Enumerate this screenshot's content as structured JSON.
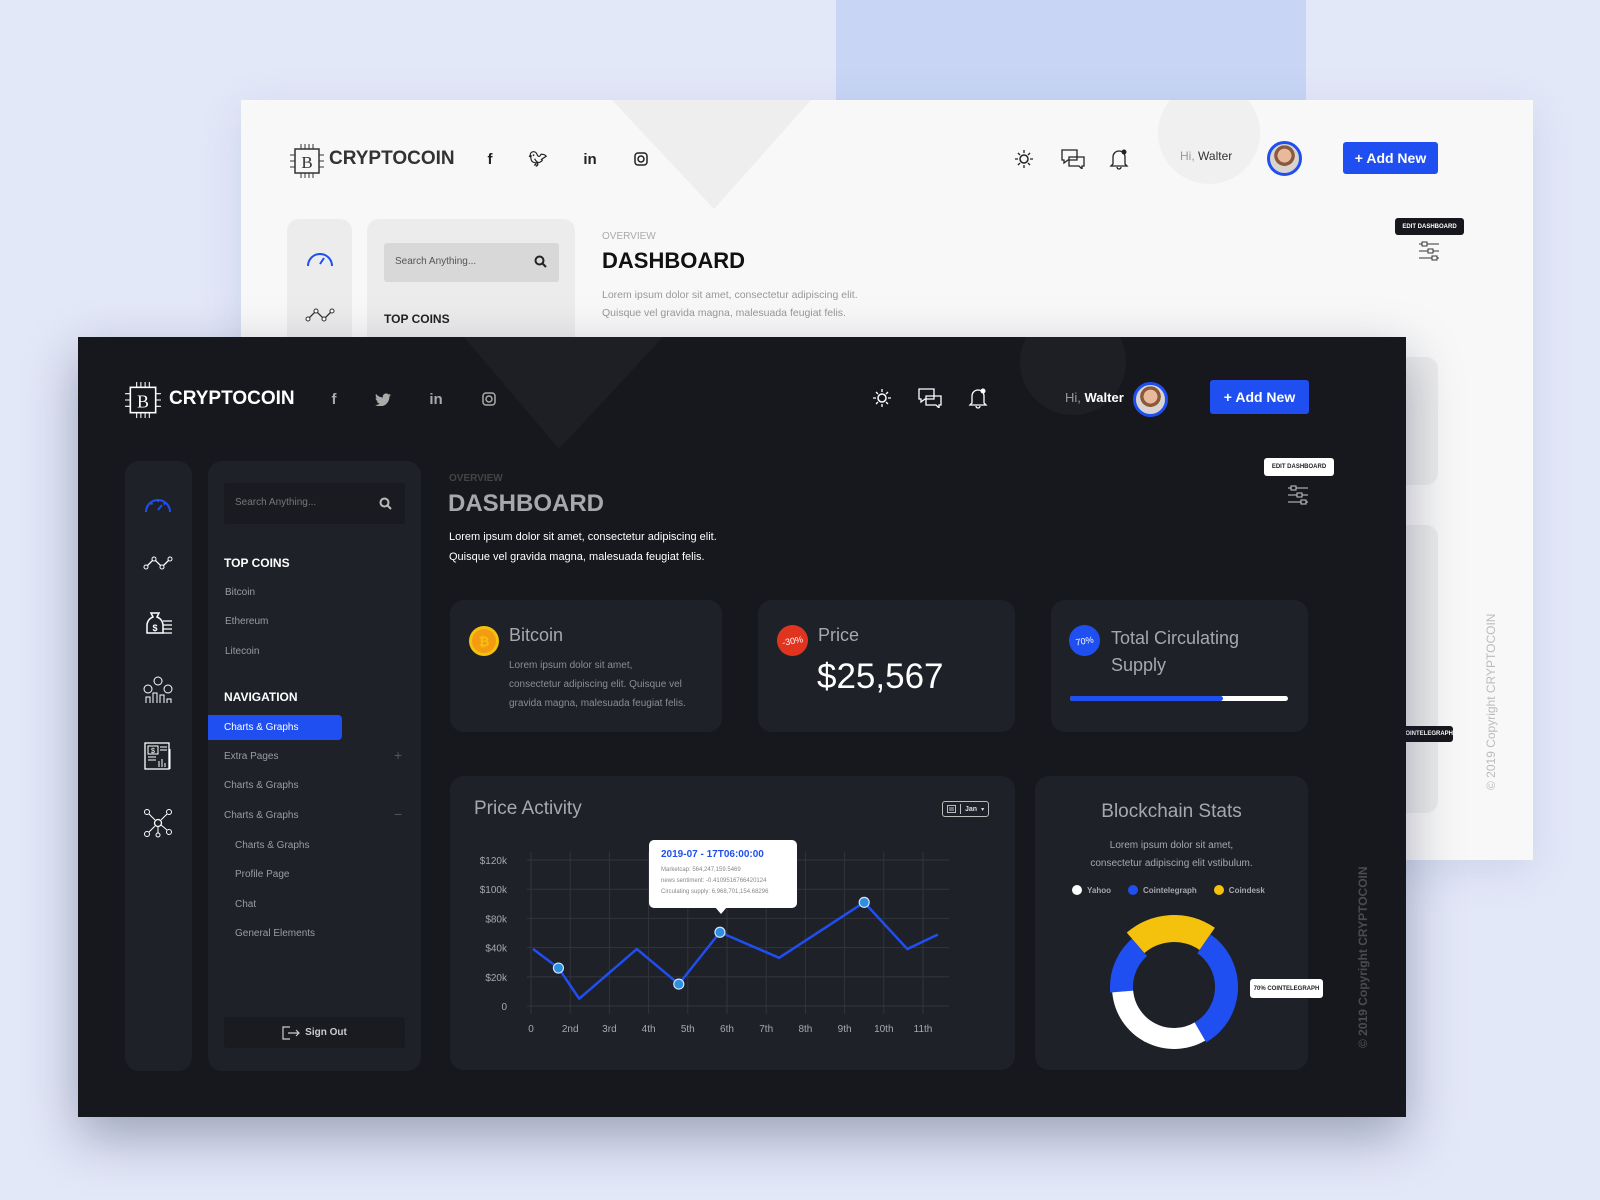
{
  "brand": "CRYPTOCOIN",
  "social": [
    "facebook-icon",
    "twitter-icon",
    "linkedin-icon",
    "instagram-icon"
  ],
  "header": {
    "greeting": "Hi,",
    "user": "Walter",
    "add_new": "+ Add New"
  },
  "search": {
    "placeholder": "Search Anything..."
  },
  "page": {
    "overline": "OVERVIEW",
    "title": "DASHBOARD",
    "desc1": "Lorem ipsum dolor sit amet, consectetur adipiscing elit.",
    "desc2": "Quisque vel gravida magna, malesuada feugiat felis.",
    "edit": "EDIT DASHBOARD"
  },
  "sidebar": {
    "top_coins_title": "TOP COINS",
    "coins": [
      "Bitcoin",
      "Ethereum",
      "Litecoin"
    ],
    "nav_title": "NAVIGATION",
    "nav": [
      {
        "label": "Charts & Graphs",
        "active": true
      },
      {
        "label": "Extra Pages",
        "toggle": "+"
      },
      {
        "label": "Charts & Graphs"
      },
      {
        "label": "Charts & Graphs",
        "toggle": "−"
      }
    ],
    "subnav": [
      "Charts & Graphs",
      "Profile Page",
      "Chat",
      "General Elements"
    ],
    "sign_out": "Sign Out"
  },
  "cards": {
    "bitcoin": {
      "title": "Bitcoin",
      "text1": "Lorem ipsum dolor sit amet,",
      "text2": "consectetur adipiscing elit. Quisque vel",
      "text3": "gravida magna, malesuada feugiat felis."
    },
    "price": {
      "title": "Price",
      "badge": "-30%",
      "value": "$25,567"
    },
    "supply": {
      "title1": "Total Circulating",
      "title2": "Supply",
      "badge": "70%",
      "progress": 0.7
    }
  },
  "colors": {
    "accent": "#1f4ff0",
    "red": "#e0341e",
    "yellow": "#f4c20d",
    "white": "#ffffff"
  },
  "chart_data": [
    {
      "type": "line",
      "title": "Price Activity",
      "filter": "Jan",
      "categories": [
        "0",
        "2nd",
        "3rd",
        "4th",
        "5th",
        "6th",
        "7th",
        "8th",
        "9th",
        "10th",
        "11th"
      ],
      "y_ticks": [
        "0",
        "$20k",
        "$40k",
        "$80k",
        "$100k",
        "$120k"
      ],
      "y_tick_values": [
        0,
        20000,
        40000,
        80000,
        100000,
        120000
      ],
      "x": [
        0.05,
        0.7,
        1.23,
        2.7,
        3.77,
        4.82,
        6.33,
        8.5,
        9.6,
        10.38
      ],
      "y": [
        39000,
        26000,
        5000,
        39000,
        15000,
        61000,
        33000,
        91000,
        39000,
        58000
      ],
      "markers": [
        1,
        4,
        5,
        7
      ],
      "grid": true,
      "tooltip": {
        "title": "2019-07 - 17T06:00:00",
        "line1": "Marketcap: 564,247,159.5469",
        "line2": "news sentiment: -0.4109516766420124",
        "line3": "Circulating supply: 6,968,701,154.68296"
      }
    },
    {
      "type": "pie",
      "title": "Blockchain Stats",
      "desc1": "Lorem ipsum dolor sit amet,",
      "desc2": "consectetur adipiscing elit vstibulum.",
      "legend": [
        {
          "name": "Yahoo",
          "color": "#ffffff"
        },
        {
          "name": "Cointelegraph",
          "color": "#1f4ff0"
        },
        {
          "name": "Coindesk",
          "color": "#f4c20d"
        }
      ],
      "segments": [
        {
          "series": "Cointelegraph",
          "value": 15
        },
        {
          "series": "Coindesk",
          "value": 21
        },
        {
          "series": "Cointelegraph",
          "value": 32
        },
        {
          "series": "Yahoo",
          "value": 32
        }
      ],
      "tooltip": "70% COINTELEGRAPH"
    }
  ],
  "copyright": "© 2019 Copyright CRYPTOCOIN",
  "back_tooltip": "COINTELEGRAPH"
}
